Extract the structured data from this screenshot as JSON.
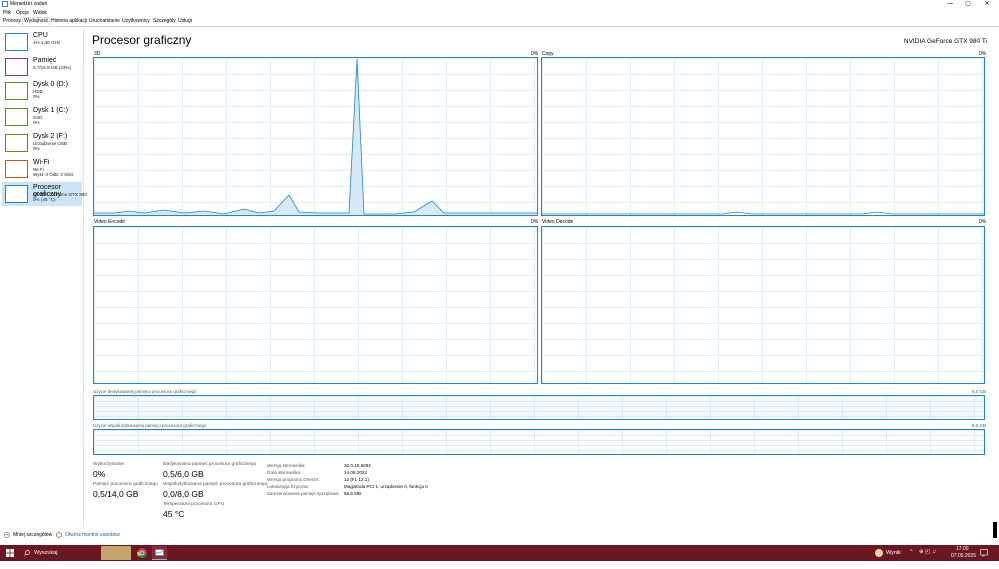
{
  "window": {
    "title": "Menedżer zadań",
    "minimize": "—",
    "maximize": "▢",
    "close": "✕"
  },
  "menu": [
    "Plik",
    "Opcje",
    "Widok"
  ],
  "tabs": [
    "Procesy",
    "Wydajność",
    "Historia aplikacji",
    "Uruchamianie",
    "Użytkownicy",
    "Szczegóły",
    "Usługi"
  ],
  "active_tab": "Wydajność",
  "sidebar": {
    "items": [
      {
        "name": "CPU",
        "line2": "1% 1,36 GHz",
        "line3": "",
        "color": "#1f86c7"
      },
      {
        "name": "Pamięć",
        "line2": "3,7/15,9 GB (23%)",
        "line3": "",
        "color": "#8a2db5"
      },
      {
        "name": "Dysk 0 (D:)",
        "line2": "HDD",
        "line3": "0%",
        "color": "#4e9a06"
      },
      {
        "name": "Dysk 1 (C:)",
        "line2": "SSD",
        "line3": "0%",
        "color": "#4e9a06"
      },
      {
        "name": "Dysk 2 (F:)",
        "line2": "Urządzenie USB",
        "line3": "0%",
        "color": "#4e9a06"
      },
      {
        "name": "Wi-Fi",
        "line2": "Wi-Fi",
        "line3": "Wysł: 0 Odb: 0 Kb/s",
        "color": "#b85c1b"
      },
      {
        "name": "Procesor graficzny",
        "line2": "NVIDIA GeForce GTX 980",
        "line3": "0% (45 °C)",
        "color": "#1f86c7"
      }
    ]
  },
  "main": {
    "title": "Procesor graficzny",
    "gpu_name": "NVIDIA GeForce GTX 980 Ti",
    "engines": [
      {
        "label": "3D",
        "percent": "0%"
      },
      {
        "label": "Copy",
        "percent": "0%"
      },
      {
        "label": "Video Encode",
        "percent": "0%"
      },
      {
        "label": "Video Decode",
        "percent": "0%"
      }
    ],
    "dedicated_label": "Użycie dedykowanej pamięci procesora graficznego",
    "dedicated_max": "6,0 GB",
    "shared_label": "Użycie współużytkowanej pamięci procesora graficznego",
    "shared_max": "8,0 GB"
  },
  "stats": {
    "utilization_label": "Wykorzystanie",
    "utilization_value": "0%",
    "gpu_memory_label": "Pamięć procesora graficznego",
    "gpu_memory_value": "0,5/14,0 GB",
    "dedicated_label": "Dedykowana pamięć procesora graficznego",
    "dedicated_value": "0,5/6,0 GB",
    "shared_label": "Współużytkowana pamięć procesora graficznego",
    "shared_value": "0,0/8,0 GB",
    "temp_label": "Temperatura procesora GPU",
    "temp_value": "45 °C"
  },
  "info": [
    {
      "key": "Wersja sterownika:",
      "value": "32.0.15.6094"
    },
    {
      "key": "Data sterownika:",
      "value": "14.08.2024"
    },
    {
      "key": "Wersja programu DirectX:",
      "value": "12 (FL 12.1)"
    },
    {
      "key": "Lokalizacja fizyczna:",
      "value": "Magistrala PCI 1, urządzenie 0, funkcja 0"
    },
    {
      "key": "Zarezerwowana pamięć sprzętowa:",
      "value": "58,6 MB"
    }
  ],
  "footer": {
    "less_details": "Mniej szczegółów",
    "resource_monitor": "Otwórz monitor zasobów"
  },
  "taskbar": {
    "search": "Wyszukaj",
    "weather": "Wynik",
    "time": "17:00",
    "date": "07.05.2025"
  }
}
